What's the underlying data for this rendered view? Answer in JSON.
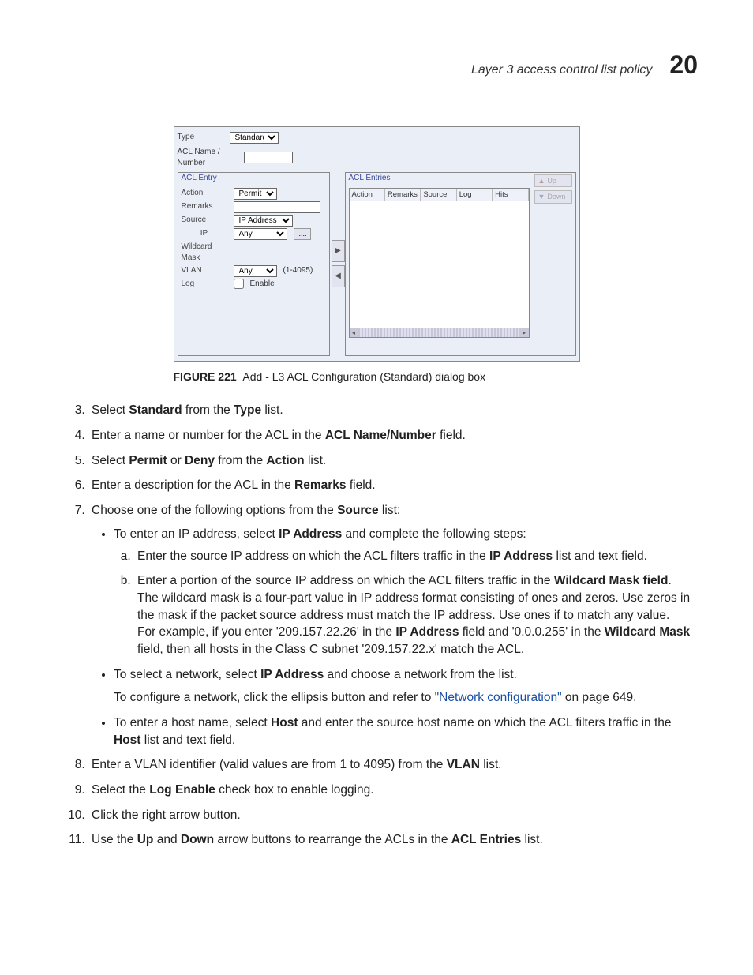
{
  "header": {
    "title": "Layer 3 access control list policy",
    "chapter": "20"
  },
  "figure": {
    "caption_prefix": "FIGURE 221",
    "caption_text": "Add - L3 ACL Configuration (Standard) dialog box",
    "top": {
      "type_label": "Type",
      "type_value": "Standard",
      "name_label": "ACL Name / Number"
    },
    "entry": {
      "pane_title": "ACL Entry",
      "action_label": "Action",
      "action_value": "Permit",
      "remarks_label": "Remarks",
      "source_label": "Source",
      "source_value": "IP Address",
      "ip_label": "IP",
      "ip_value": "Any",
      "ip_ellipsis": "....",
      "wildcard_label": "Wildcard Mask",
      "vlan_label": "VLAN",
      "vlan_value": "Any",
      "vlan_hint": "(1-4095)",
      "log_label": "Log",
      "log_cb_label": "Enable"
    },
    "entries": {
      "pane_title": "ACL Entries",
      "cols": [
        "Action",
        "Remarks",
        "Source",
        "Log",
        "Hits"
      ],
      "up_label": "Up",
      "down_label": "Down"
    }
  },
  "steps": {
    "n3": {
      "t1": "Select ",
      "b1": "Standard",
      "t2": " from the ",
      "b2": "Type",
      "t3": " list."
    },
    "n4": {
      "t1": "Enter a name or number for the ACL in the ",
      "b1": "ACL Name/Number",
      "t2": " field."
    },
    "n5": {
      "t1": "Select ",
      "b1": "Permit",
      "t2": " or ",
      "b2": "Deny",
      "t3": " from the ",
      "b3": "Action",
      "t4": " list."
    },
    "n6": {
      "t1": "Enter a description for the ACL in the ",
      "b1": "Remarks",
      "t2": " field."
    },
    "n7": {
      "t1": "Choose one of the following options from the ",
      "b1": "Source",
      "t2": " list:"
    },
    "b7a": {
      "t1": "To enter an IP address, select ",
      "b1": "IP Address",
      "t2": " and complete the following steps:"
    },
    "s7a1": {
      "t1": "Enter the source IP address on which the ACL filters traffic in the ",
      "b1": "IP Address",
      "t2": " list and text field."
    },
    "s7a2": {
      "t1": "Enter a portion of the source IP address on which the ACL filters traffic in the ",
      "b1": "Wildcard Mask field",
      "t2": ".",
      "p1": "The wildcard mask is a four-part value in IP address format consisting of ones and zeros. Use zeros in the mask if the packet source address must match the IP address. Use ones if to match any value.",
      "p2a": "For example, if you enter '209.157.22.26' in the ",
      "p2b": "IP Address",
      "p2c": " field and '0.0.0.255' in the ",
      "p2d": "Wildcard Mask",
      "p2e": " field, then all hosts in the Class C subnet '209.157.22.x' match the ACL."
    },
    "b7b": {
      "t1": "To select a network, select ",
      "b1": "IP Address",
      "t2": " and choose a network from the list.",
      "p1a": "To configure a network, click the ellipsis button and refer to ",
      "p1link": "\"Network configuration\"",
      "p1b": " on page 649."
    },
    "b7c": {
      "t1": "To enter a host name, select ",
      "b1": "Host",
      "t2": " and enter the source host name on which the ACL filters traffic in the ",
      "b2": "Host",
      "t3": " list and text field."
    },
    "n8": {
      "t1": "Enter a VLAN identifier (valid values are from 1 to 4095) from the ",
      "b1": "VLAN",
      "t2": " list."
    },
    "n9": {
      "t1": "Select the ",
      "b1": "Log Enable",
      "t2": " check box to enable logging."
    },
    "n10": {
      "t1": "Click the right arrow button."
    },
    "n11": {
      "t1": "Use the ",
      "b1": "Up",
      "t2": " and ",
      "b2": "Down",
      "t3": " arrow buttons to rearrange the ACLs in the ",
      "b3": "ACL Entries",
      "t4": " list."
    }
  }
}
